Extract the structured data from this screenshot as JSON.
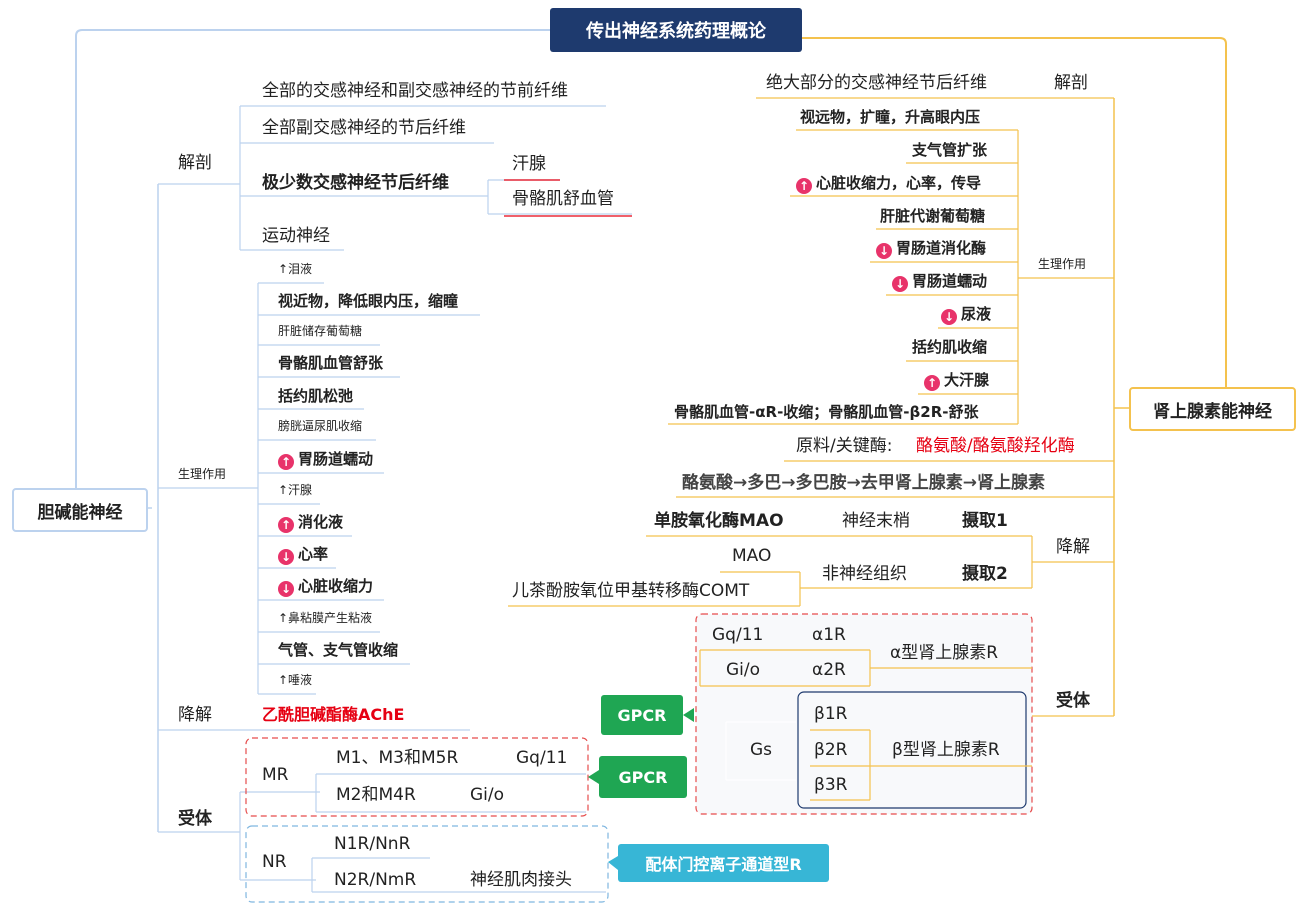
{
  "title": "传出神经系统药理概论",
  "cholinergic": {
    "name": "胆碱能神经",
    "anatomy": {
      "label": "解剖",
      "items": [
        "全部的交感神经和副交感神经的节前纤维",
        "全部副交感神经的节后纤维",
        "极少数交感神经节后纤维",
        "运动神经"
      ],
      "sub": [
        "汗腺",
        "骨骼肌舒血管"
      ]
    },
    "physiology": {
      "label": "生理作用",
      "items": [
        "↑泪液",
        "视近物，降低眼内压，缩瞳",
        "肝脏储存葡萄糖",
        "骨骼肌血管舒张",
        "括约肌松弛",
        "膀胱逼尿肌收缩",
        "胃肠道蠕动",
        "↑汗腺",
        "消化液",
        "心率",
        "心脏收缩力",
        "↑鼻粘膜产生粘液",
        "气管、支气管收缩",
        "↑唾液"
      ]
    },
    "degradation": {
      "label": "降解",
      "value": "乙酰胆碱酯酶AChE"
    },
    "receptors": {
      "label": "受体",
      "mr": {
        "label": "MR",
        "r1": "M1、M3和M5R",
        "g1": "Gq/11",
        "r2": "M2和M4R",
        "g2": "Gi/o"
      },
      "nr": {
        "label": "NR",
        "r1": "N1R/NnR",
        "r2": "N2R/NmR",
        "loc": "神经肌肉接头"
      },
      "gpcr": "GPCR",
      "ligand": "配体门控离子通道型R"
    }
  },
  "adrenergic": {
    "name": "肾上腺素能神经",
    "anatomy": {
      "label": "解剖",
      "value": "绝大部分的交感神经节后纤维"
    },
    "physiology": {
      "label": "生理作用",
      "items": [
        "视远物，扩瞳，升高眼内压",
        "支气管扩张",
        "心脏收缩力，心率，传导",
        "肝脏代谢葡萄糖",
        "胃肠道消化酶",
        "胃肠道蠕动",
        "尿液",
        "括约肌收缩",
        "大汗腺",
        "骨骼肌血管-αR-收缩；骨骼肌血管-β2R-舒张"
      ]
    },
    "material": {
      "label": "原料/关键酶:",
      "value": "酪氨酸/酪氨酸羟化酶"
    },
    "synthesis": "酪氨酸→多巴→多巴胺→去甲肾上腺素→肾上腺素",
    "degradation": {
      "label": "降解",
      "mao_full": "单胺氧化酶MAO",
      "terminal": "神经末梢",
      "uptake1": "摄取1",
      "mao": "MAO",
      "comt": "儿茶酚胺氧位甲基转移酶COMT",
      "non_neural": "非神经组织",
      "uptake2": "摄取2"
    },
    "receptors": {
      "label": "受体",
      "alpha": {
        "label": "α型肾上腺素R",
        "g1": "Gq/11",
        "r1": "α1R",
        "g2": "Gi/o",
        "r2": "α2R"
      },
      "beta": {
        "label": "β型肾上腺素R",
        "g": "Gs",
        "r1": "β1R",
        "r2": "β2R",
        "r3": "β3R"
      },
      "gpcr": "GPCR"
    }
  },
  "colors": {
    "root": "#1e3a6e",
    "red": "#e60012",
    "gpcr": "#1fa653",
    "ligand": "#37b6d6",
    "chol_line": "#bcd2ee",
    "adr_line": "#f4c24e"
  }
}
